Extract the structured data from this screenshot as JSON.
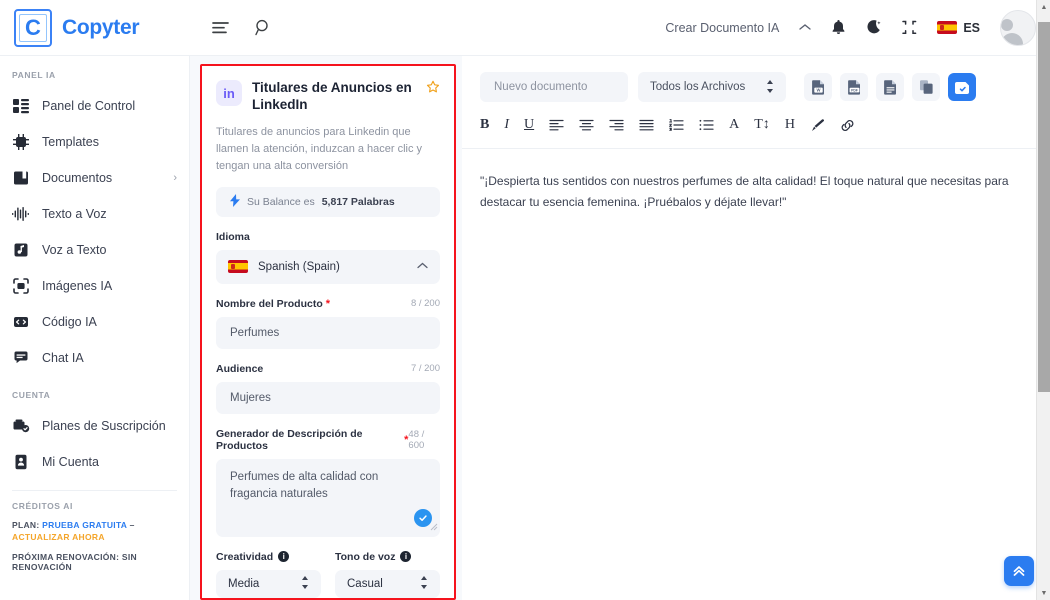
{
  "brand": {
    "logo_letter": "C",
    "name": "Copyter"
  },
  "topbar": {
    "menu_icon": "menu-icon",
    "search_icon": "search-icon",
    "create_doc_label": "Crear Documento IA",
    "chevron_icon": "chevron-up-icon",
    "bell_icon": "bell-icon",
    "moon_icon": "moon-icon",
    "fullscreen_icon": "compress-icon",
    "lang_code": "ES",
    "flag_icon": "spain-flag-icon",
    "avatar_icon": "user-avatar-icon"
  },
  "sidebar": {
    "section_panel": "PANEL IA",
    "items": [
      {
        "label": "Panel de Control",
        "icon": "dashboard-icon"
      },
      {
        "label": "Templates",
        "icon": "chip-ai-icon"
      },
      {
        "label": "Documentos",
        "icon": "book-icon",
        "caret": "›"
      },
      {
        "label": "Texto a Voz",
        "icon": "waveform-icon"
      },
      {
        "label": "Voz a Texto",
        "icon": "audio-file-icon"
      },
      {
        "label": "Imágenes IA",
        "icon": "camera-frame-icon"
      },
      {
        "label": "Código IA",
        "icon": "code-icon"
      },
      {
        "label": "Chat IA",
        "icon": "chat-icon"
      }
    ],
    "section_account": "CUENTA",
    "account_items": [
      {
        "label": "Planes de Suscripción",
        "icon": "subscription-icon"
      },
      {
        "label": "Mi Cuenta",
        "icon": "id-card-icon"
      }
    ],
    "section_credits": "CRÉDITOS AI",
    "plan_prefix": "PLAN:",
    "plan_value": "PRUEBA GRATUITA",
    "plan_dash": "–",
    "plan_upgrade": "ACTUALIZAR AHORA",
    "renewal": "PRÓXIMA RENOVACIÓN: SIN RENOVACIÓN"
  },
  "template_panel": {
    "badge": "in",
    "badge_icon": "linkedin-icon",
    "title": "Titulares de Anuncios en LinkedIn",
    "star_icon": "star-outline-icon",
    "description": "Titulares de anuncios para Linkedin que llamen la atención, induzcan a hacer clic y tengan una alta conversión",
    "balance_icon": "bolt-icon",
    "balance_prefix": "Su Balance es",
    "balance_value": "5,817 Palabras",
    "language_label": "Idioma",
    "language_value": "Spanish (Spain)",
    "language_flag": "spain-flag-icon",
    "language_caret": "chevron-up-icon",
    "product_label": "Nombre del Producto",
    "product_required": "*",
    "product_counter": "8 / 200",
    "product_value": "Perfumes",
    "audience_label": "Audience",
    "audience_counter": "7 / 200",
    "audience_value": "Mujeres",
    "description_label": "Generador de Descripción de Productos",
    "description_required": "*",
    "description_counter": "48 / 600",
    "description_value": "Perfumes de alta calidad con fragancia naturales",
    "check_icon": "check-circle-icon",
    "creativity_label": "Creatividad",
    "creativity_info": "i",
    "creativity_value": "Media",
    "tone_label": "Tono de voz",
    "tone_info": "i",
    "tone_value": "Casual"
  },
  "editor": {
    "doc_name_placeholder": "Nuevo documento",
    "file_filter_value": "Todos los Archivos",
    "export_buttons": [
      {
        "name": "export-word-button",
        "label": "W"
      },
      {
        "name": "export-pdf-button",
        "label": "PDF"
      },
      {
        "name": "export-txt-button",
        "label": ""
      },
      {
        "name": "copy-button",
        "label": ""
      },
      {
        "name": "save-document-button",
        "label": ""
      }
    ],
    "toolbar": [
      {
        "name": "bold-button",
        "glyph": "B"
      },
      {
        "name": "italic-button",
        "glyph": "I"
      },
      {
        "name": "underline-button",
        "glyph": "U"
      },
      {
        "name": "align-left-button",
        "glyph": "align-left-icon"
      },
      {
        "name": "align-center-button",
        "glyph": "align-center-icon"
      },
      {
        "name": "align-right-button",
        "glyph": "align-right-icon"
      },
      {
        "name": "align-justify-button",
        "glyph": "align-justify-icon"
      },
      {
        "name": "ordered-list-button",
        "glyph": "ordered-list-icon"
      },
      {
        "name": "bullet-list-button",
        "glyph": "bullet-list-icon"
      },
      {
        "name": "font-color-button",
        "glyph": "A"
      },
      {
        "name": "font-size-button",
        "glyph": "T↕"
      },
      {
        "name": "heading-button",
        "glyph": "H"
      },
      {
        "name": "highlight-button",
        "glyph": "brush-icon"
      },
      {
        "name": "link-button",
        "glyph": "link-icon"
      }
    ],
    "content": "\"¡Despierta tus sentidos con nuestros perfumes de alta calidad! El toque natural que necesitas para destacar tu esencia femenina. ¡Pruébalos y déjate llevar!\"",
    "scroll_top_icon": "double-chevron-up-icon"
  },
  "colors": {
    "brand_blue": "#2b7cf0",
    "accent_blue": "#2b94f0",
    "highlight_border": "#f5131d",
    "upgrade_orange": "#f4a52a",
    "linkedin_purple": "#6b5cf6",
    "star_gold": "#f0a21e"
  }
}
